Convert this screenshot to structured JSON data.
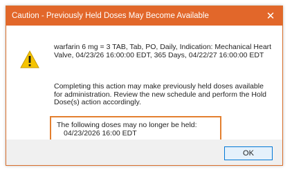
{
  "dialog": {
    "title": "Caution - Previously Held Doses May Become Available",
    "close_icon": "close-icon",
    "warning_icon": "warning-icon",
    "order_text": "warfarin 6 mg = 3 TAB, Tab, PO, Daily, Indication: Mechanical Heart Valve, 04/23/26 16:00:00 EDT, 365 Days, 04/22/27 16:00:00 EDT",
    "message_text": "Completing this action may make previously held doses available for administration. Review the new schedule and perform the Hold Dose(s) action accordingly.",
    "held_heading": "The following doses may no longer be held:",
    "held_dose": "04/23/2026 16:00 EDT",
    "ok_label": "OK"
  },
  "colors": {
    "title_bar": "#e2672a",
    "highlight_border": "#e37f2f",
    "warning_fill": "#f5c400",
    "button_border": "#0078d7"
  }
}
